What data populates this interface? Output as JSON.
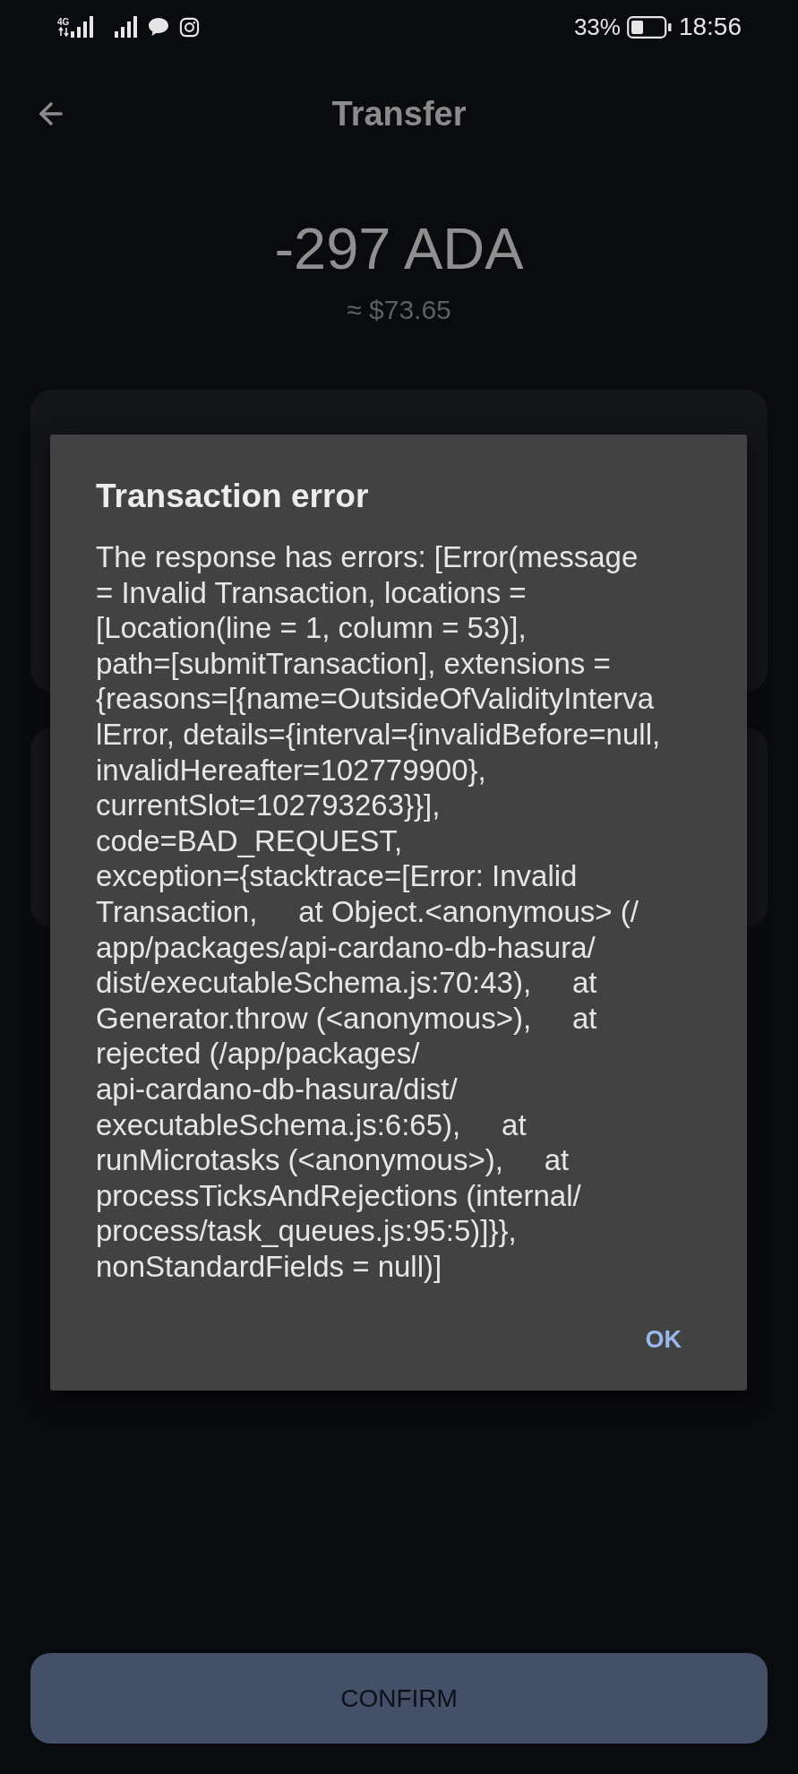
{
  "status_bar": {
    "network": "4G",
    "battery": "33%",
    "time": "18:56"
  },
  "header": {
    "title": "Transfer"
  },
  "amount": {
    "value": "-297 ADA",
    "fiat": "≈ $73.65"
  },
  "dialog": {
    "title": "Transaction error",
    "message_lines": [
      "The response has errors: [Error(message",
      "= Invalid Transaction, locations =",
      "[Location(line = 1, column = 53)],",
      "path=[submitTransaction], extensions =",
      "{reasons=[{name=OutsideOfValidityInterva",
      "lError, details={interval={invalidBefore=null,",
      "invalidHereafter=102779900},",
      "currentSlot=102793263}}],",
      "code=BAD_REQUEST,",
      "exception={stacktrace=[Error: Invalid",
      "Transaction,     at Object.<anonymous> (/",
      "app/packages/api-cardano-db-hasura/",
      "dist/executableSchema.js:70:43),     at",
      "Generator.throw (<anonymous>),     at",
      "rejected (/app/packages/",
      "api-cardano-db-hasura/dist/",
      "executableSchema.js:6:65),     at",
      "runMicrotasks (<anonymous>),     at",
      "processTicksAndRejections (internal/",
      "process/task_queues.js:95:5)]}},",
      "nonStandardFields = null)]"
    ],
    "button": "OK"
  },
  "confirm_button": {
    "label": "CONFIRM"
  }
}
